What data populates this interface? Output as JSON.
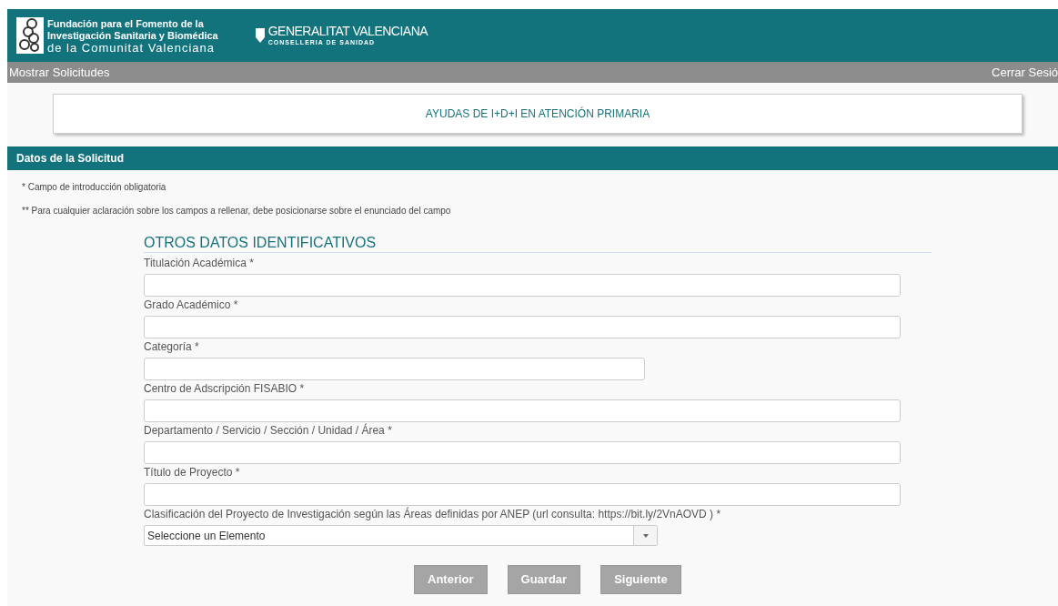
{
  "header": {
    "foundation_lines": [
      "Fundación para el Fomento de la",
      "Investigación Sanitaria y Biomédica",
      "de la Comunitat Valenciana"
    ],
    "gov_title": "GENERALITAT VALENCIANA",
    "gov_subtitle": "CONSELLERIA DE SANIDAD"
  },
  "nav": {
    "left": "Mostrar Solicitudes",
    "right": "Cerrar Sesió"
  },
  "program_title": "AYUDAS DE I+D+I EN ATENCIÓN PRIMARIA",
  "section_title": "Datos de la Solicitud",
  "notes": [
    "* Campo de introducción obligatoria",
    "** Para cualquier aclaración sobre los campos a rellenar, debe posicionarse sobre el enunciado del campo"
  ],
  "form": {
    "heading": "OTROS DATOS IDENTIFICATIVOS",
    "fields": [
      {
        "kind": "text",
        "label": "Titulación Académica *",
        "wide": true
      },
      {
        "kind": "text",
        "label": "Grado Académico *",
        "wide": true
      },
      {
        "kind": "text",
        "label": "Categoría *",
        "wide": false
      },
      {
        "kind": "text",
        "label": "Centro de Adscripción FISABIO *",
        "wide": true
      },
      {
        "kind": "text",
        "label": "Departamento / Servicio / Sección / Unidad / Área *",
        "wide": true
      },
      {
        "kind": "text",
        "label": "Título de Proyecto *",
        "wide": true
      },
      {
        "kind": "select",
        "label": "Clasificación del Proyecto de Investigación según las Áreas definidas por ANEP (url consulta: https://bit.ly/2VnAOVD ) *",
        "value": "Seleccione un Elemento",
        "wide": false
      }
    ]
  },
  "buttons": [
    "Anterior",
    "Guardar",
    "Siguiente"
  ]
}
